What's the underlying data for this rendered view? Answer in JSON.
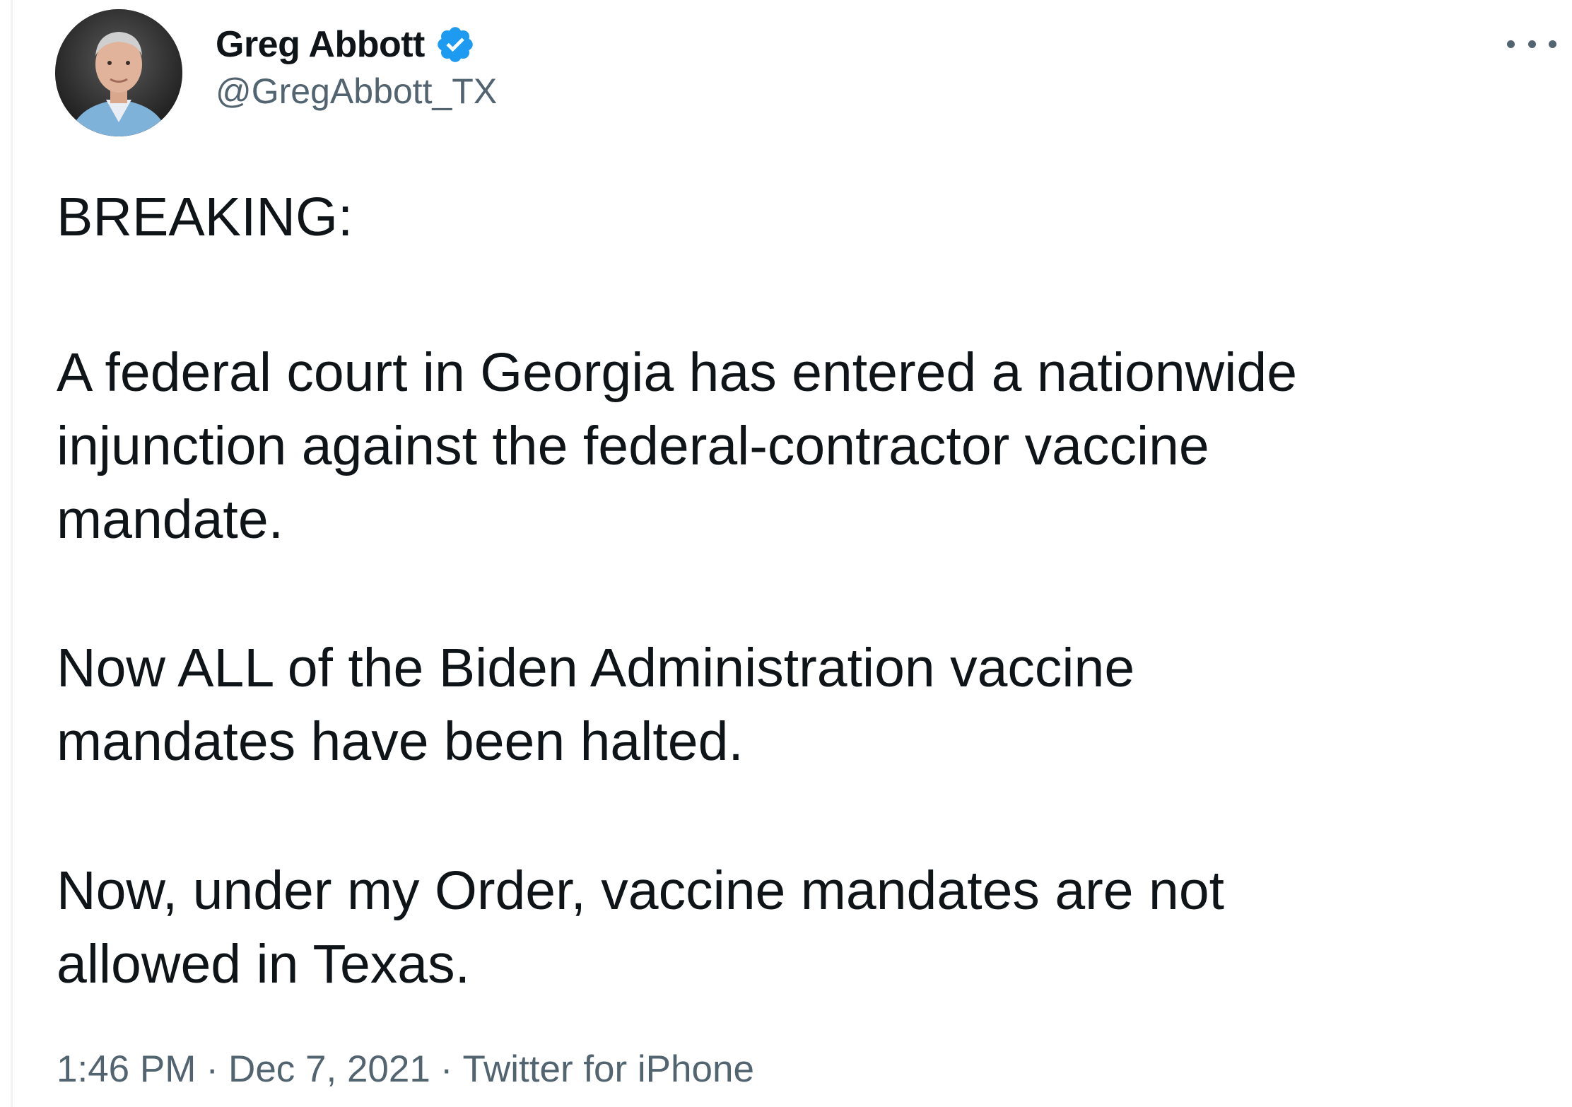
{
  "author": {
    "display_name": "Greg Abbott",
    "handle": "@GregAbbott_TX",
    "verified_icon": "verified-badge-icon",
    "avatar_icon": "profile-photo"
  },
  "tweet": {
    "lines": [
      "BREAKING:",
      "A federal court in Georgia has entered a nationwide",
      "injunction against the federal-contractor vaccine",
      "mandate.",
      "Now ALL of the Biden Administration vaccine",
      "mandates have been halted.",
      "Now, under my Order, vaccine mandates are not",
      "allowed in Texas."
    ]
  },
  "meta": {
    "time": "1:46 PM",
    "separator": "·",
    "date": "Dec 7, 2021",
    "source": "Twitter for iPhone"
  },
  "colors": {
    "text": "#0f1419",
    "secondary": "#536471",
    "verified_blue": "#1d9bf0"
  }
}
